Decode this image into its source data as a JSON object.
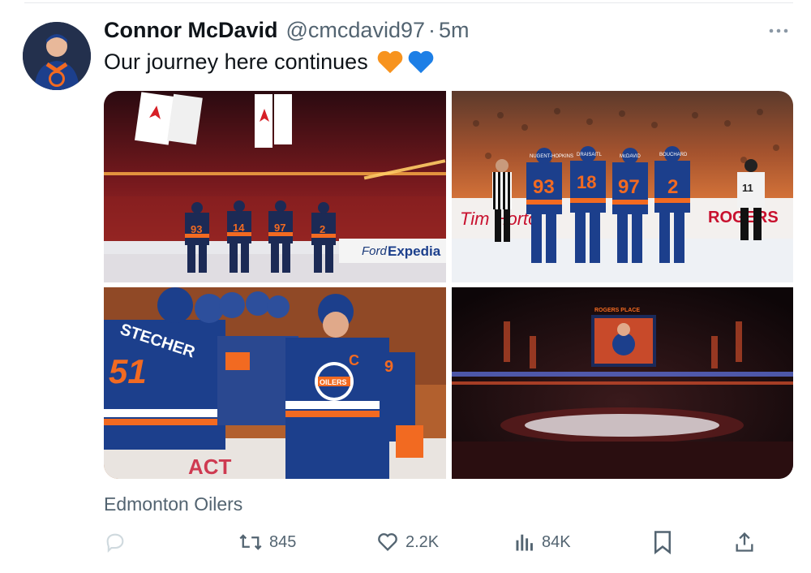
{
  "tweet": {
    "author_name": "Connor McDavid",
    "handle": "@cmcdavid97",
    "separator": "·",
    "time": "5m",
    "text": "Our journey here continues",
    "location": "Edmonton Oilers"
  },
  "media": {
    "tile1": {
      "board_brand": "Expedia",
      "board_brand2": "Ford",
      "numbers": [
        "93",
        "14",
        "97",
        "2"
      ]
    },
    "tile2": {
      "board_left": "Tim Horto",
      "board_right": "ROGERS",
      "numbers": [
        "93",
        "18",
        "97",
        "2",
        "11"
      ],
      "names": [
        "NUGENT-HOPKINS",
        "DRAISAITL",
        "McDAVID",
        "BOUCHARD"
      ]
    },
    "tile3": {
      "jersey_name": "STECHER",
      "jersey_number": "51",
      "captain_letter": "C",
      "crest_text": "OILERS",
      "side_number": "9",
      "board_text": "ACT"
    },
    "tile4": {
      "arena_sign": "ROGERS PLACE"
    }
  },
  "actions": {
    "reply_count": "",
    "retweet_count": "845",
    "like_count": "2.2K",
    "views_count": "84K"
  },
  "colors": {
    "oilers_blue": "#1c3f8c",
    "oilers_orange": "#f26a21",
    "muted_text": "#536471",
    "orange_heart": "#f7931e",
    "blue_heart": "#1d7fe6"
  }
}
